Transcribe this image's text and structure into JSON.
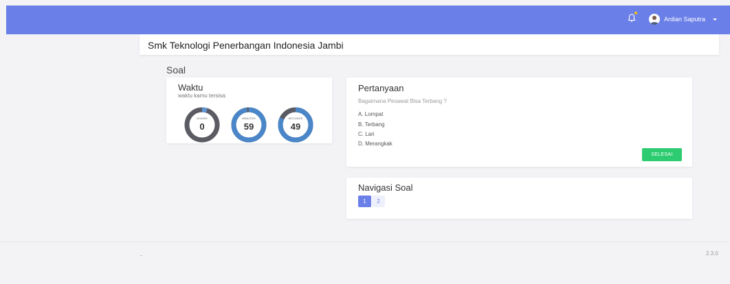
{
  "header": {
    "user_name": "Ardian Saputra",
    "accent": "#6b7fe8",
    "icons": [
      "bell-icon",
      "avatar",
      "chevron-down-icon"
    ]
  },
  "school": {
    "title": "Smk Teknologi Penerbangan Indonesia Jambi"
  },
  "page": {
    "section_title": "Soal"
  },
  "timer": {
    "title": "Waktu",
    "subtitle": "waktu kamu tersisa:",
    "rings": [
      {
        "label": "HOURS",
        "value": "0",
        "fraction": 0.05
      },
      {
        "label": "MINUTES",
        "value": "59",
        "fraction": 0.98
      },
      {
        "label": "SECONDS",
        "value": "49",
        "fraction": 0.82
      }
    ]
  },
  "question_card": {
    "title": "Pertanyaan",
    "question": "Bagaimana Pesawat Bisa Terbang ?",
    "options": [
      "A. Lompat",
      "B. Terbang",
      "C. Lari",
      "D. Merangkak"
    ],
    "finish_label": "SELESAI",
    "finish_color": "#2ecc71"
  },
  "navigation": {
    "title": "Navigasi Soal",
    "pages": [
      "1",
      "2"
    ],
    "active": "1"
  },
  "footer": {
    "left": "-",
    "version": "2.3.0"
  }
}
